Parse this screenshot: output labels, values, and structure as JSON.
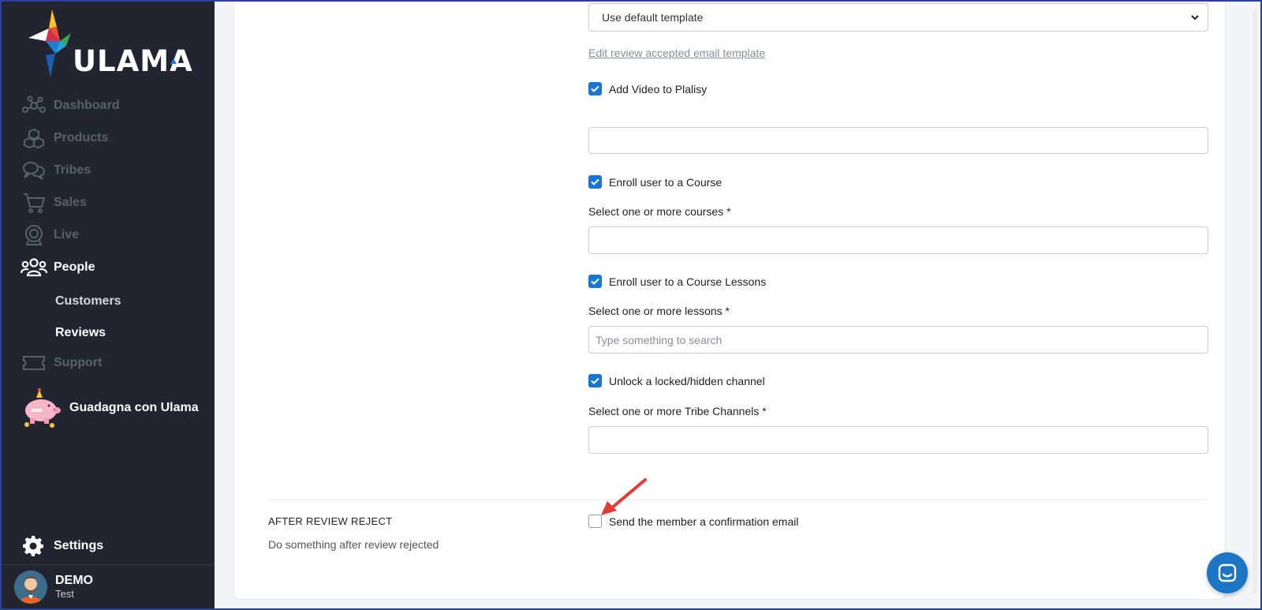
{
  "brand": {
    "name": "ULAMA"
  },
  "sidebar": {
    "items": [
      {
        "label": "Dashboard",
        "icon": "network-icon"
      },
      {
        "label": "Products",
        "icon": "cubes-icon"
      },
      {
        "label": "Tribes",
        "icon": "chat-bubbles-icon"
      },
      {
        "label": "Sales",
        "icon": "cart-icon"
      },
      {
        "label": "Live",
        "icon": "webcam-icon"
      },
      {
        "label": "People",
        "icon": "people-icon"
      },
      {
        "label": "Support",
        "icon": "ticket-icon"
      }
    ],
    "sub_items": [
      {
        "label": "Customers"
      },
      {
        "label": "Reviews"
      }
    ],
    "promo": {
      "label": "Guadagna con Ulama"
    },
    "settings": {
      "label": "Settings"
    },
    "user": {
      "name": "DEMO",
      "role": "Test"
    }
  },
  "form": {
    "template_select": {
      "value": "Use default template"
    },
    "edit_template_link": "Edit review accepted email template",
    "add_video": {
      "label": "Add Video to Plalisy",
      "checked": true,
      "value": ""
    },
    "enroll_course": {
      "label": "Enroll user to a Course",
      "checked": true,
      "field_label": "Select one or more courses *",
      "value": ""
    },
    "enroll_lessons": {
      "label": "Enroll user to a Course Lessons",
      "checked": true,
      "field_label": "Select one or more lessons *",
      "placeholder": "Type something to search"
    },
    "unlock_channel": {
      "label": "Unlock a locked/hidden channel",
      "checked": true,
      "field_label": "Select one or more Tribe Channels *",
      "value": ""
    },
    "after_reject": {
      "title": "AFTER REVIEW REJECT",
      "description": "Do something after review rejected",
      "confirmation_email": {
        "label": "Send the member a confirmation email",
        "checked": false
      }
    }
  },
  "colors": {
    "sidebar_bg": "#22252f",
    "accent": "#1976d2",
    "chat_button": "#1c75c4",
    "annotation_arrow": "#e53935"
  }
}
